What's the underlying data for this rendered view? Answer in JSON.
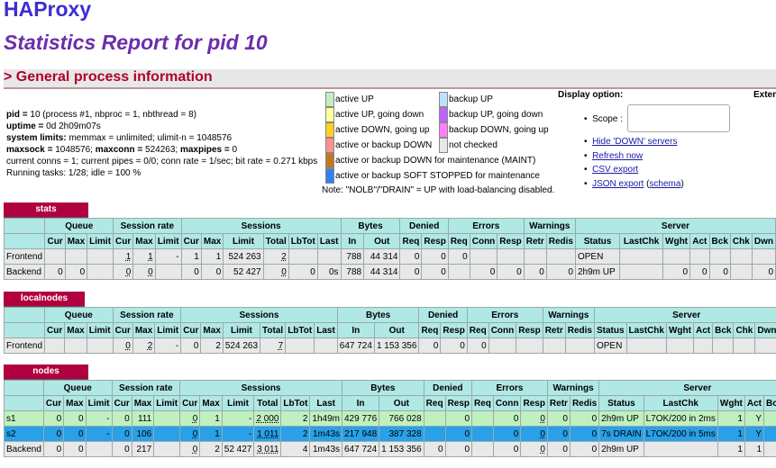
{
  "header": {
    "logo": "HAProxy",
    "title": "Statistics Report for pid 10",
    "section": "> General process information"
  },
  "info": {
    "pid_label": "pid =",
    "pid_value": " 10 (process #1, nbproc = 1, nbthread = 8)",
    "uptime_label": "uptime =",
    "uptime_value": " 0d 2h09m07s",
    "limits_label": "system limits:",
    "limits_value": " memmax = unlimited; ulimit-n = 1048576",
    "maxsock_label": "maxsock =",
    "maxsock_value": " 1048576;",
    "maxconn_label": "maxconn =",
    "maxconn_value": " 524263;",
    "maxpipes_label": "maxpipes =",
    "maxpipes_value": " 0",
    "conns": "current conns = 1; current pipes = 0/0; conn rate = 1/sec; bit rate = 0.271 kbps",
    "tasks": "Running tasks: 1/28; idle = 100 %"
  },
  "legend": {
    "left": [
      {
        "label": "active UP",
        "color": "#c0f0c0"
      },
      {
        "label": "active UP, going down",
        "color": "#ffffa0"
      },
      {
        "label": "active DOWN, going up",
        "color": "#ffd020"
      },
      {
        "label": "active or backup DOWN",
        "color": "#ff9090"
      },
      {
        "label": "active or backup DOWN for maintenance (MAINT)",
        "color": "#c07820"
      },
      {
        "label": "active or backup SOFT STOPPED for maintenance",
        "color": "#3080f0"
      }
    ],
    "right": [
      {
        "label": "backup UP",
        "color": "#c0e0ff"
      },
      {
        "label": "backup UP, going down",
        "color": "#c060ff"
      },
      {
        "label": "backup DOWN, going up",
        "color": "#ff80ff"
      },
      {
        "label": "not checked",
        "color": "#e8e8e8"
      }
    ],
    "note": "Note: \"NOLB\"/\"DRAIN\" = UP with load-balancing disabled."
  },
  "display": {
    "title": "Display option:",
    "external": "Exter",
    "scope_label": "Scope :",
    "hide_down": "Hide 'DOWN' servers",
    "refresh": "Refresh now",
    "csv": "CSV export",
    "json": "JSON export",
    "schema": "schema"
  },
  "proxies": {
    "stats": {
      "name": "stats",
      "groups": [
        "",
        "Queue",
        "Session rate",
        "Sessions",
        "Bytes",
        "Denied",
        "Errors",
        "Warnings",
        "Server"
      ],
      "cols": [
        "",
        "Cur",
        "Max",
        "Limit",
        "Cur",
        "Max",
        "Limit",
        "Cur",
        "Max",
        "Limit",
        "Total",
        "LbTot",
        "Last",
        "In",
        "Out",
        "Req",
        "Resp",
        "Req",
        "Conn",
        "Resp",
        "Retr",
        "Redis",
        "Status",
        "LastChk",
        "Wght",
        "Act",
        "Bck",
        "Chk",
        "Dwn"
      ],
      "rows": [
        [
          "Frontend",
          "",
          "",
          "",
          "1",
          "1",
          "-",
          "1",
          "1",
          "524 263",
          "2",
          "",
          "",
          "788",
          "44 314",
          "0",
          "0",
          "0",
          "",
          "",
          "",
          "",
          "OPEN",
          "",
          "",
          "",
          "",
          "",
          ""
        ],
        [
          "Backend",
          "0",
          "0",
          "",
          "0",
          "0",
          "",
          "0",
          "0",
          "52 427",
          "0",
          "0",
          "0s",
          "788",
          "44 314",
          "0",
          "0",
          "",
          "0",
          "0",
          "0",
          "0",
          "2h9m UP",
          "",
          "0",
          "0",
          "0",
          "",
          "0"
        ]
      ]
    },
    "localnodes": {
      "name": "localnodes",
      "groups": [
        "",
        "Queue",
        "Session rate",
        "Sessions",
        "Bytes",
        "Denied",
        "Errors",
        "Warnings",
        "Server"
      ],
      "cols": [
        "",
        "Cur",
        "Max",
        "Limit",
        "Cur",
        "Max",
        "Limit",
        "Cur",
        "Max",
        "Limit",
        "Total",
        "LbTot",
        "Last",
        "In",
        "Out",
        "Req",
        "Resp",
        "Req",
        "Conn",
        "Resp",
        "Retr",
        "Redis",
        "Status",
        "LastChk",
        "Wght",
        "Act",
        "Bck",
        "Chk",
        "Dwn"
      ],
      "rows": [
        [
          "Frontend",
          "",
          "",
          "",
          "0",
          "2",
          "-",
          "0",
          "2",
          "524 263",
          "7",
          "",
          "",
          "647 724",
          "1 153 356",
          "0",
          "0",
          "0",
          "",
          "",
          "",
          "",
          "OPEN",
          "",
          "",
          "",
          "",
          "",
          ""
        ]
      ]
    },
    "nodes": {
      "name": "nodes",
      "groups": [
        "",
        "Queue",
        "Session rate",
        "Sessions",
        "Bytes",
        "Denied",
        "Errors",
        "Warnings",
        "Server"
      ],
      "cols": [
        "",
        "Cur",
        "Max",
        "Limit",
        "Cur",
        "Max",
        "Limit",
        "Cur",
        "Max",
        "Limit",
        "Total",
        "LbTot",
        "Last",
        "In",
        "Out",
        "Req",
        "Resp",
        "Req",
        "Conn",
        "Resp",
        "Retr",
        "Redis",
        "Status",
        "LastChk",
        "Wght",
        "Act",
        "Bck",
        "C"
      ],
      "rows": [
        [
          "s1",
          "0",
          "0",
          "-",
          "0",
          "111",
          "",
          "0",
          "1",
          "-",
          "2 000",
          "2",
          "1h49m",
          "429 776",
          "766 028",
          "",
          "0",
          "",
          "0",
          "0",
          "0",
          "0",
          "2h9m UP",
          "L7OK/200 in 2ms",
          "1",
          "Y",
          "-",
          ""
        ],
        [
          "s2",
          "0",
          "0",
          "-",
          "0",
          "106",
          "",
          "0",
          "1",
          "-",
          "1 011",
          "2",
          "1m43s",
          "217 948",
          "387 328",
          "",
          "0",
          "",
          "0",
          "0",
          "0",
          "0",
          "7s DRAIN",
          "L7OK/200 in 5ms",
          "1",
          "Y",
          "-",
          ""
        ],
        [
          "Backend",
          "0",
          "0",
          "",
          "0",
          "217",
          "",
          "0",
          "2",
          "52 427",
          "3 011",
          "4",
          "1m43s",
          "647 724",
          "1 153 356",
          "0",
          "0",
          "",
          "0",
          "0",
          "0",
          "0",
          "2h9m UP",
          "",
          "1",
          "1",
          "0",
          ""
        ]
      ]
    }
  }
}
